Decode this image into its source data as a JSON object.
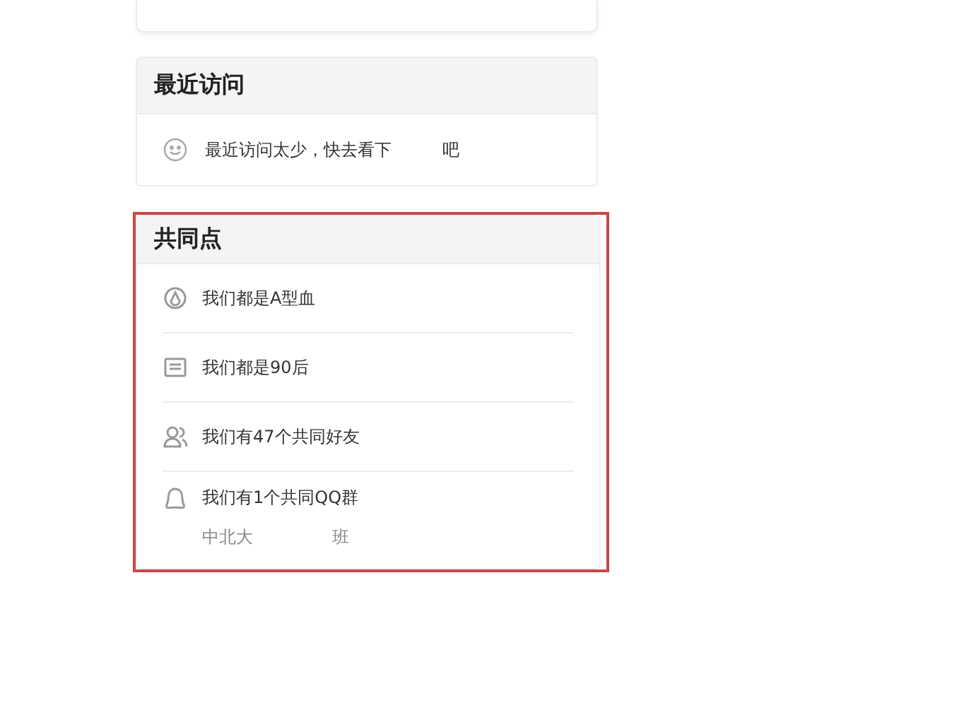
{
  "recent": {
    "title": "最近访问",
    "message": "最近访问太少，快去看下",
    "message_end": "吧"
  },
  "common": {
    "title": "共同点",
    "highlighted": true,
    "items": [
      {
        "kind": "blood",
        "text": "我们都是A型血"
      },
      {
        "kind": "age",
        "text": "我们都是90后"
      },
      {
        "kind": "friends",
        "text": "我们有47个共同好友"
      },
      {
        "kind": "group",
        "text": "我们有1个共同QQ群",
        "sub": [
          "中北大",
          "班"
        ]
      }
    ]
  }
}
